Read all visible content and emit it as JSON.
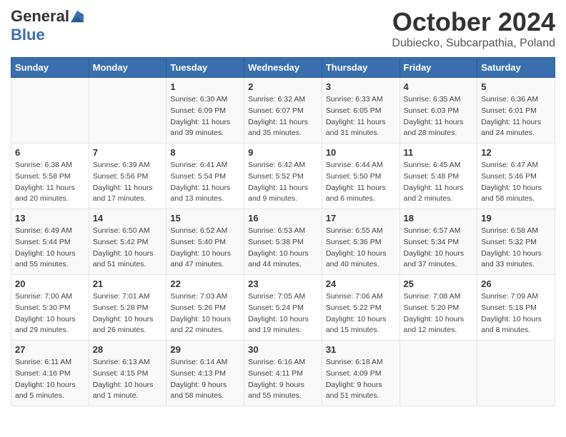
{
  "header": {
    "logo_general": "General",
    "logo_blue": "Blue",
    "month": "October 2024",
    "location": "Dubiecko, Subcarpathia, Poland"
  },
  "weekdays": [
    "Sunday",
    "Monday",
    "Tuesday",
    "Wednesday",
    "Thursday",
    "Friday",
    "Saturday"
  ],
  "rows": [
    [
      {
        "day": "",
        "info": ""
      },
      {
        "day": "",
        "info": ""
      },
      {
        "day": "1",
        "info": "Sunrise: 6:30 AM\nSunset: 6:09 PM\nDaylight: 11 hours and 39 minutes."
      },
      {
        "day": "2",
        "info": "Sunrise: 6:32 AM\nSunset: 6:07 PM\nDaylight: 11 hours and 35 minutes."
      },
      {
        "day": "3",
        "info": "Sunrise: 6:33 AM\nSunset: 6:05 PM\nDaylight: 11 hours and 31 minutes."
      },
      {
        "day": "4",
        "info": "Sunrise: 6:35 AM\nSunset: 6:03 PM\nDaylight: 11 hours and 28 minutes."
      },
      {
        "day": "5",
        "info": "Sunrise: 6:36 AM\nSunset: 6:01 PM\nDaylight: 11 hours and 24 minutes."
      }
    ],
    [
      {
        "day": "6",
        "info": "Sunrise: 6:38 AM\nSunset: 5:58 PM\nDaylight: 11 hours and 20 minutes."
      },
      {
        "day": "7",
        "info": "Sunrise: 6:39 AM\nSunset: 5:56 PM\nDaylight: 11 hours and 17 minutes."
      },
      {
        "day": "8",
        "info": "Sunrise: 6:41 AM\nSunset: 5:54 PM\nDaylight: 11 hours and 13 minutes."
      },
      {
        "day": "9",
        "info": "Sunrise: 6:42 AM\nSunset: 5:52 PM\nDaylight: 11 hours and 9 minutes."
      },
      {
        "day": "10",
        "info": "Sunrise: 6:44 AM\nSunset: 5:50 PM\nDaylight: 11 hours and 6 minutes."
      },
      {
        "day": "11",
        "info": "Sunrise: 6:45 AM\nSunset: 5:48 PM\nDaylight: 11 hours and 2 minutes."
      },
      {
        "day": "12",
        "info": "Sunrise: 6:47 AM\nSunset: 5:46 PM\nDaylight: 10 hours and 58 minutes."
      }
    ],
    [
      {
        "day": "13",
        "info": "Sunrise: 6:49 AM\nSunset: 5:44 PM\nDaylight: 10 hours and 55 minutes."
      },
      {
        "day": "14",
        "info": "Sunrise: 6:50 AM\nSunset: 5:42 PM\nDaylight: 10 hours and 51 minutes."
      },
      {
        "day": "15",
        "info": "Sunrise: 6:52 AM\nSunset: 5:40 PM\nDaylight: 10 hours and 47 minutes."
      },
      {
        "day": "16",
        "info": "Sunrise: 6:53 AM\nSunset: 5:38 PM\nDaylight: 10 hours and 44 minutes."
      },
      {
        "day": "17",
        "info": "Sunrise: 6:55 AM\nSunset: 5:36 PM\nDaylight: 10 hours and 40 minutes."
      },
      {
        "day": "18",
        "info": "Sunrise: 6:57 AM\nSunset: 5:34 PM\nDaylight: 10 hours and 37 minutes."
      },
      {
        "day": "19",
        "info": "Sunrise: 6:58 AM\nSunset: 5:32 PM\nDaylight: 10 hours and 33 minutes."
      }
    ],
    [
      {
        "day": "20",
        "info": "Sunrise: 7:00 AM\nSunset: 5:30 PM\nDaylight: 10 hours and 29 minutes."
      },
      {
        "day": "21",
        "info": "Sunrise: 7:01 AM\nSunset: 5:28 PM\nDaylight: 10 hours and 26 minutes."
      },
      {
        "day": "22",
        "info": "Sunrise: 7:03 AM\nSunset: 5:26 PM\nDaylight: 10 hours and 22 minutes."
      },
      {
        "day": "23",
        "info": "Sunrise: 7:05 AM\nSunset: 5:24 PM\nDaylight: 10 hours and 19 minutes."
      },
      {
        "day": "24",
        "info": "Sunrise: 7:06 AM\nSunset: 5:22 PM\nDaylight: 10 hours and 15 minutes."
      },
      {
        "day": "25",
        "info": "Sunrise: 7:08 AM\nSunset: 5:20 PM\nDaylight: 10 hours and 12 minutes."
      },
      {
        "day": "26",
        "info": "Sunrise: 7:09 AM\nSunset: 5:18 PM\nDaylight: 10 hours and 8 minutes."
      }
    ],
    [
      {
        "day": "27",
        "info": "Sunrise: 6:11 AM\nSunset: 4:16 PM\nDaylight: 10 hours and 5 minutes."
      },
      {
        "day": "28",
        "info": "Sunrise: 6:13 AM\nSunset: 4:15 PM\nDaylight: 10 hours and 1 minute."
      },
      {
        "day": "29",
        "info": "Sunrise: 6:14 AM\nSunset: 4:13 PM\nDaylight: 9 hours and 58 minutes."
      },
      {
        "day": "30",
        "info": "Sunrise: 6:16 AM\nSunset: 4:11 PM\nDaylight: 9 hours and 55 minutes."
      },
      {
        "day": "31",
        "info": "Sunrise: 6:18 AM\nSunset: 4:09 PM\nDaylight: 9 hours and 51 minutes."
      },
      {
        "day": "",
        "info": ""
      },
      {
        "day": "",
        "info": ""
      }
    ]
  ]
}
